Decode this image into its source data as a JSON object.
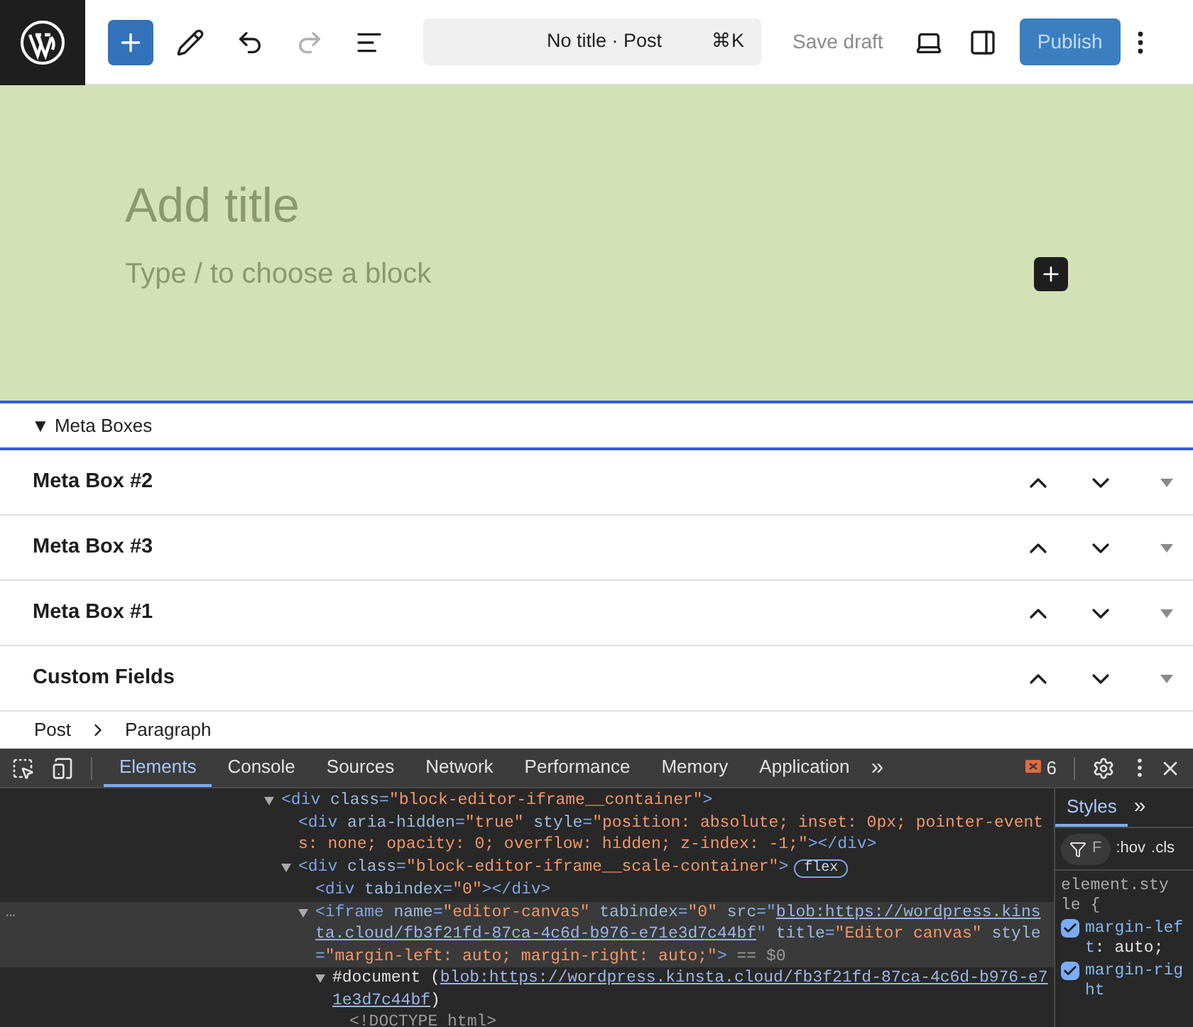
{
  "toolbar": {
    "tools": [
      {
        "kind": "inserter",
        "disabled": false
      },
      {
        "kind": "tools",
        "disabled": false
      },
      {
        "kind": "undo",
        "disabled": false
      },
      {
        "kind": "redo",
        "disabled": true
      },
      {
        "kind": "list-view",
        "disabled": false
      }
    ],
    "command_bar": {
      "title": "No title · Post",
      "shortcut": "⌘K"
    },
    "save_draft": "Save draft",
    "publish": "Publish"
  },
  "canvas": {
    "title_placeholder": "Add title",
    "block_placeholder": "Type / to choose a block"
  },
  "meta_boxes": {
    "heading": "▼ Meta Boxes",
    "panels": [
      {
        "title": "Meta Box #2"
      },
      {
        "title": "Meta Box #3"
      },
      {
        "title": "Meta Box #1"
      },
      {
        "title": "Custom Fields"
      }
    ]
  },
  "breadcrumb": [
    "Post",
    "Paragraph"
  ],
  "devtools": {
    "tabs": [
      {
        "label": "Elements",
        "selected": true
      },
      {
        "label": "Console",
        "selected": false
      },
      {
        "label": "Sources",
        "selected": false
      },
      {
        "label": "Network",
        "selected": false
      },
      {
        "label": "Performance",
        "selected": false
      },
      {
        "label": "Memory",
        "selected": false
      },
      {
        "label": "Application",
        "selected": false
      }
    ],
    "more_tabs": "»",
    "issues_count": "6",
    "dom_tree": [
      {
        "expanded": true,
        "selected": false,
        "parts": [
          {
            "kind": "tag",
            "text": "<div "
          },
          {
            "kind": "attr",
            "text": "class"
          },
          {
            "kind": "tag",
            "text": "="
          },
          {
            "kind": "value",
            "text": "\"block-editor-iframe__container\""
          },
          {
            "kind": "tag",
            "text": ">"
          }
        ],
        "children": [
          {
            "selected": false,
            "parts": [
              {
                "kind": "tag",
                "text": "<div "
              },
              {
                "kind": "attr",
                "text": "aria-hidden"
              },
              {
                "kind": "tag",
                "text": "="
              },
              {
                "kind": "value",
                "text": "\"true\" "
              },
              {
                "kind": "attr",
                "text": "style"
              },
              {
                "kind": "tag",
                "text": "="
              },
              {
                "kind": "value",
                "text": "\"position: absolute; inset: 0px; pointer-events: none; opacity: 0; overflow: hidden; z-index: -1;\""
              },
              {
                "kind": "tag",
                "text": "></div>"
              }
            ]
          },
          {
            "expanded": true,
            "selected": false,
            "badge": "flex",
            "parts": [
              {
                "kind": "tag",
                "text": "<div "
              },
              {
                "kind": "attr",
                "text": "class"
              },
              {
                "kind": "tag",
                "text": "="
              },
              {
                "kind": "value",
                "text": "\"block-editor-iframe__scale-container\""
              },
              {
                "kind": "tag",
                "text": ">"
              }
            ],
            "children": [
              {
                "selected": false,
                "parts": [
                  {
                    "kind": "tag",
                    "text": "<div "
                  },
                  {
                    "kind": "attr",
                    "text": "tabindex"
                  },
                  {
                    "kind": "tag",
                    "text": "="
                  },
                  {
                    "kind": "value",
                    "text": "\"0\""
                  },
                  {
                    "kind": "tag",
                    "text": "></div>"
                  }
                ]
              },
              {
                "expanded": true,
                "selected": true,
                "gutter": "…",
                "parts": [
                  {
                    "kind": "tag",
                    "text": "<iframe "
                  },
                  {
                    "kind": "attr",
                    "text": "name"
                  },
                  {
                    "kind": "tag",
                    "text": "="
                  },
                  {
                    "kind": "value",
                    "text": "\"editor-canvas\" "
                  },
                  {
                    "kind": "attr",
                    "text": "tabindex"
                  },
                  {
                    "kind": "tag",
                    "text": "="
                  },
                  {
                    "kind": "value",
                    "text": "\"0\" "
                  },
                  {
                    "kind": "attr",
                    "text": "src"
                  },
                  {
                    "kind": "tag",
                    "text": "=\""
                  },
                  {
                    "kind": "link",
                    "text": "blob:https://wordpress.kinsta.cloud/fb3f21fd-87ca-4c6d-b976-e71e3d7c44bf"
                  },
                  {
                    "kind": "tag",
                    "text": "\" "
                  },
                  {
                    "kind": "attr",
                    "text": "title"
                  },
                  {
                    "kind": "tag",
                    "text": "="
                  },
                  {
                    "kind": "value",
                    "text": "\"Editor canvas\" "
                  },
                  {
                    "kind": "attr",
                    "text": "style"
                  },
                  {
                    "kind": "tag",
                    "text": "="
                  },
                  {
                    "kind": "value",
                    "text": "\"margin-left: auto; margin-right: auto;\""
                  },
                  {
                    "kind": "tag",
                    "text": ">"
                  },
                  {
                    "kind": "dim",
                    "text": " == $0"
                  }
                ],
                "children": [
                  {
                    "expanded": true,
                    "selected": false,
                    "parts": [
                      {
                        "kind": "text",
                        "text": "#document ("
                      },
                      {
                        "kind": "link",
                        "text": "blob:https://wordpress.kinsta.cloud/fb3f21fd-87ca-4c6d-b976-e71e3d7c44bf"
                      },
                      {
                        "kind": "text",
                        "text": ")"
                      }
                    ],
                    "children": [
                      {
                        "selected": false,
                        "parts": [
                          {
                            "kind": "dim",
                            "text": "<!DOCTYPE html>"
                          }
                        ]
                      }
                    ]
                  }
                ]
              }
            ]
          }
        ]
      }
    ],
    "styles": {
      "tabs": [
        {
          "label": "Styles",
          "selected": true
        }
      ],
      "more": "»",
      "filter_placeholder": "F",
      "hov": ":hov",
      "cls": ".cls",
      "selector": "element.style {",
      "properties": [
        {
          "name": "margin-left",
          "value": ": auto;",
          "checked": true
        },
        {
          "name": "margin-right",
          "checked": true
        }
      ]
    }
  }
}
